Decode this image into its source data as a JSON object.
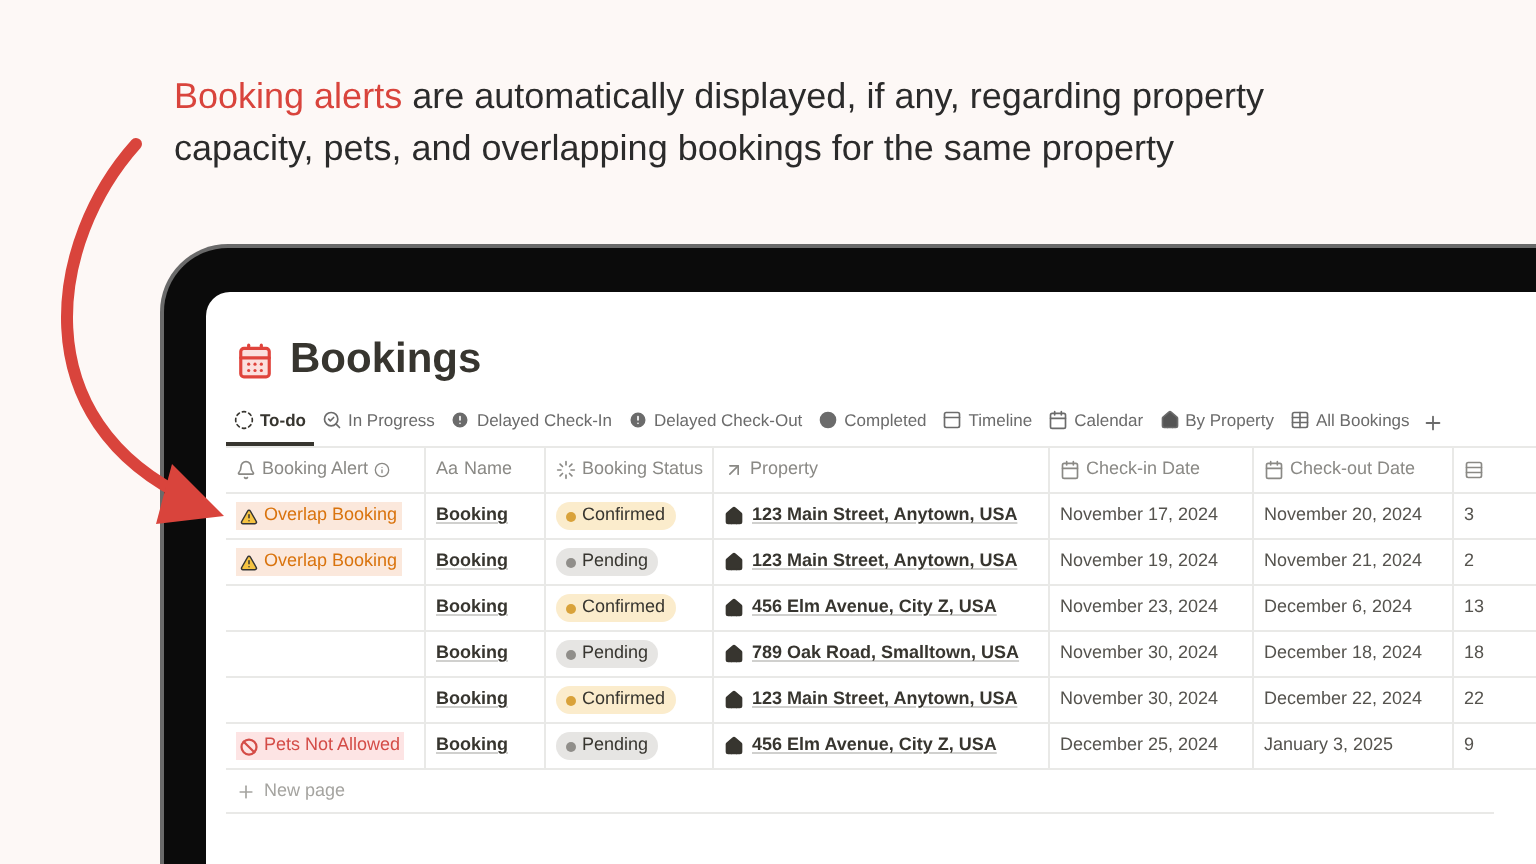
{
  "headline": {
    "highlight": "Booking alerts",
    "rest": " are automatically displayed, if any, regarding property capacity, pets, and overlapping bookings for the same property"
  },
  "page": {
    "title": "Bookings"
  },
  "tabs": [
    {
      "label": "To-do",
      "selected": true
    },
    {
      "label": "In Progress",
      "selected": false
    },
    {
      "label": "Delayed Check-In",
      "selected": false
    },
    {
      "label": "Delayed Check-Out",
      "selected": false
    },
    {
      "label": "Completed",
      "selected": false
    },
    {
      "label": "Timeline",
      "selected": false
    },
    {
      "label": "Calendar",
      "selected": false
    },
    {
      "label": "By Property",
      "selected": false
    },
    {
      "label": "All Bookings",
      "selected": false
    }
  ],
  "table": {
    "columns": [
      {
        "label": "Booking Alert"
      },
      {
        "label": "Name",
        "prefix": "Aa"
      },
      {
        "label": "Booking Status"
      },
      {
        "label": "Property"
      },
      {
        "label": "Check-in Date"
      },
      {
        "label": "Check-out Date"
      },
      {}
    ],
    "rows": [
      {
        "alert": {
          "kind": "overlap",
          "text": "Overlap Booking"
        },
        "name": "Booking",
        "status": {
          "kind": "confirmed",
          "text": "Confirmed"
        },
        "property": "123 Main Street, Anytown, USA",
        "checkin": "November 17, 2024",
        "checkout": "November 20, 2024",
        "nights": "3"
      },
      {
        "alert": {
          "kind": "overlap",
          "text": "Overlap Booking"
        },
        "name": "Booking",
        "status": {
          "kind": "pending",
          "text": "Pending"
        },
        "property": "123 Main Street, Anytown, USA",
        "checkin": "November 19, 2024",
        "checkout": "November 21, 2024",
        "nights": "2"
      },
      {
        "name": "Booking",
        "status": {
          "kind": "confirmed",
          "text": "Confirmed"
        },
        "property": "456 Elm Avenue, City Z, USA",
        "checkin": "November 23, 2024",
        "checkout": "December 6, 2024",
        "nights": "13"
      },
      {
        "name": "Booking",
        "status": {
          "kind": "pending",
          "text": "Pending"
        },
        "property": "789 Oak Road, Smalltown, USA",
        "checkin": "November 30, 2024",
        "checkout": "December 18, 2024",
        "nights": "18"
      },
      {
        "name": "Booking",
        "status": {
          "kind": "confirmed",
          "text": "Confirmed"
        },
        "property": "123 Main Street, Anytown, USA",
        "checkin": "November 30, 2024",
        "checkout": "December 22, 2024",
        "nights": "22"
      },
      {
        "alert": {
          "kind": "pets",
          "text": "Pets Not Allowed"
        },
        "name": "Booking",
        "status": {
          "kind": "pending",
          "text": "Pending"
        },
        "property": "456 Elm Avenue, City Z, USA",
        "checkin": "December 25, 2024",
        "checkout": "January 3, 2025",
        "nights": "9"
      }
    ],
    "new_row": "New page"
  }
}
